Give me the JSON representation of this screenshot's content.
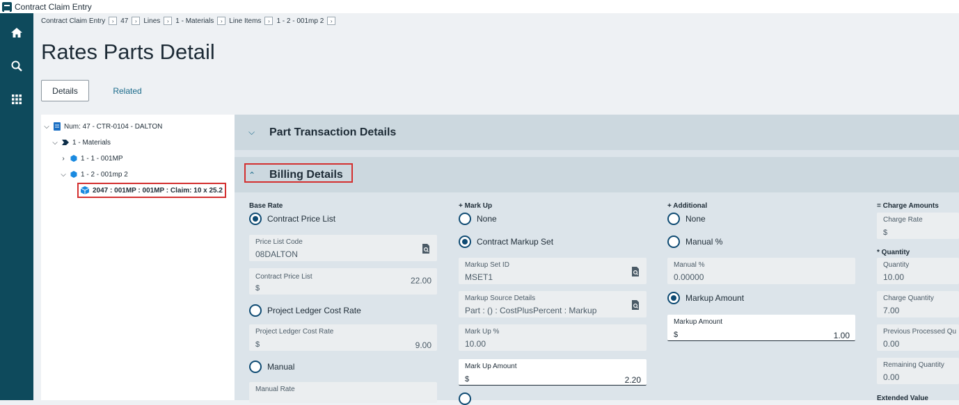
{
  "window": {
    "title": "Contract Claim Entry"
  },
  "rail": {
    "icons": [
      "home-icon",
      "search-icon",
      "apps-grid-icon"
    ]
  },
  "breadcrumb": [
    "Contract Claim Entry",
    "47",
    "Lines",
    "1 - Materials",
    "Line Items",
    "1 - 2 - 001mp 2"
  ],
  "page": {
    "title": "Rates Parts Detail"
  },
  "tabs": {
    "details": "Details",
    "related": "Related"
  },
  "tree": {
    "root": "Num: 47 - CTR-0104 - DALTON",
    "level1": "1 - Materials",
    "item1": "1 - 1 - 001MP",
    "item2": "1 - 2 - 001mp 2",
    "selected": "2047 : 001MP : 001MP : Claim: 10 x 25.2"
  },
  "sections": {
    "part_transaction": "Part Transaction Details",
    "billing": "Billing Details"
  },
  "base_rate": {
    "heading": "Base Rate",
    "option_contract": "Contract Price List",
    "price_list_code_label": "Price List Code",
    "price_list_code_value": "08DALTON",
    "contract_price_list_label": "Contract Price List",
    "contract_price_list_currency": "$",
    "contract_price_list_value": "22.00",
    "option_ledger": "Project Ledger Cost Rate",
    "ledger_label": "Project Ledger Cost Rate",
    "ledger_currency": "$",
    "ledger_value": "9.00",
    "option_manual": "Manual",
    "manual_rate_label": "Manual Rate"
  },
  "mark_up": {
    "heading": "+ Mark Up",
    "option_none": "None",
    "option_contract_set": "Contract Markup Set",
    "markup_set_id_label": "Markup Set ID",
    "markup_set_id_value": "MSET1",
    "markup_source_label": "Markup Source Details",
    "markup_source_value": "Part : () : CostPlusPercent : Markup",
    "markup_pct_label": "Mark Up %",
    "markup_pct_value": "10.00",
    "markup_amount_label": "Mark Up Amount",
    "markup_amount_currency": "$",
    "markup_amount_value": "2.20"
  },
  "additional": {
    "heading": "+ Additional",
    "option_none": "None",
    "option_manual_pct": "Manual %",
    "manual_pct_label": "Manual %",
    "manual_pct_value": "0.00000",
    "option_markup_amount": "Markup Amount",
    "markup_amount_label": "Markup Amount",
    "markup_amount_currency": "$",
    "markup_amount_value": "1.00"
  },
  "charge_amounts": {
    "heading": "= Charge Amounts",
    "charge_rate_label": "Charge Rate",
    "charge_rate_currency": "$",
    "quantity_heading": "* Quantity",
    "quantity_label": "Quantity",
    "quantity_value": "10.00",
    "charge_qty_label": "Charge Quantity",
    "charge_qty_value": "7.00",
    "prev_processed_label": "Previous Processed Qu",
    "prev_processed_value": "0.00",
    "remaining_label": "Remaining Quantity",
    "remaining_value": "0.00",
    "extended_value_heading": "Extended Value"
  },
  "colors": {
    "rail": "#0e4a5c",
    "accent": "#0e4a72",
    "highlight": "#d32f2f"
  }
}
